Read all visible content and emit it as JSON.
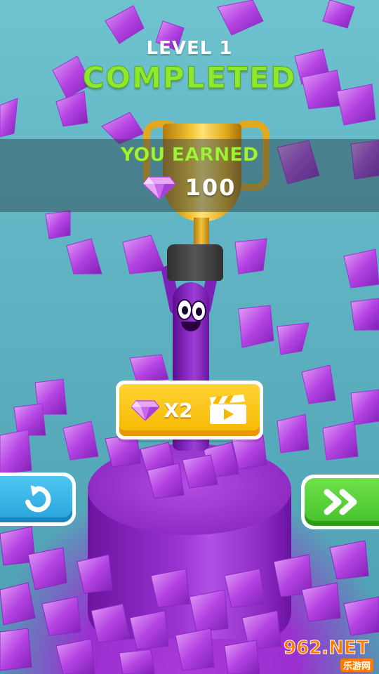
{
  "header": {
    "level_label": "LEVEL 1",
    "status_label": "COMPLETED"
  },
  "reward": {
    "label": "YOU EARNED",
    "amount": "100",
    "icon": "gem-icon"
  },
  "multiplier_button": {
    "label": "X2",
    "icons": [
      "gem-icon",
      "video-clapper-icon"
    ]
  },
  "restart_button": {
    "icon": "restart-arrow-icon"
  },
  "next_button": {
    "icon": "double-chevron-right-icon"
  },
  "watermark": {
    "main": "962.NET",
    "sub": "乐游网"
  },
  "colors": {
    "accent_green": "#8fe830",
    "button_yellow": "#f6b800",
    "button_blue": "#27a3db",
    "button_green": "#44c22a",
    "gem_purple": "#b040e0",
    "background": "#5fb3c2"
  }
}
